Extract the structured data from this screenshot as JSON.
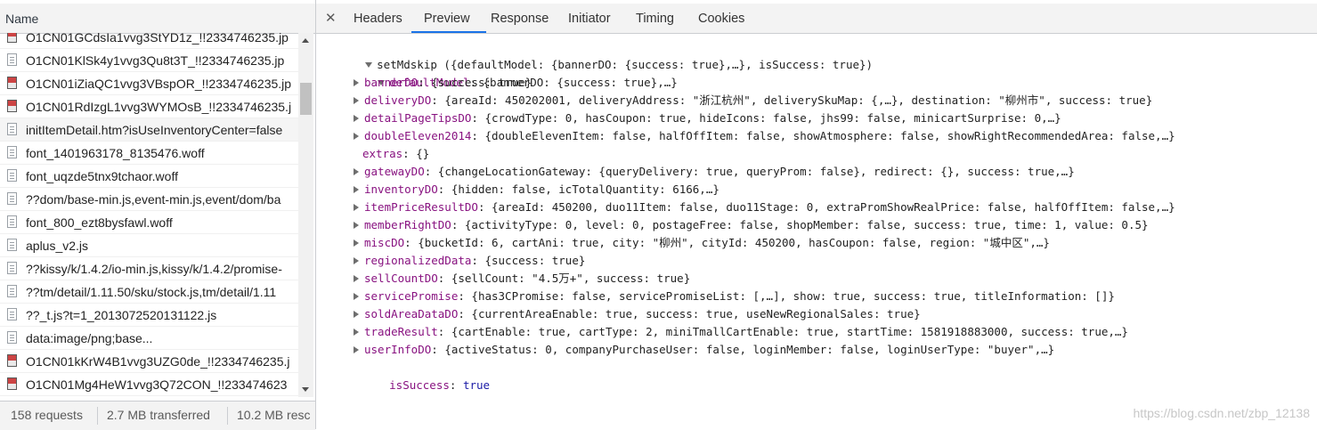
{
  "network": {
    "column_name": "Name",
    "files": [
      {
        "name": "O1CN01GCdsIa1vvg3StYD1z_!!2334746235.jp",
        "icon": "image-file-icon"
      },
      {
        "name": "O1CN01KlSk4y1vvg3Qu8t3T_!!2334746235.jp",
        "icon": "document-file-icon"
      },
      {
        "name": "O1CN01iZiaQC1vvg3VBspOR_!!2334746235.jp",
        "icon": "image-file-icon"
      },
      {
        "name": "O1CN01RdIzgL1vvg3WYMOsB_!!2334746235.j",
        "icon": "image-file-icon"
      },
      {
        "name": "initItemDetail.htm?isUseInventoryCenter=false",
        "icon": "document-file-icon"
      },
      {
        "name": "font_1401963178_8135476.woff",
        "icon": "document-file-icon"
      },
      {
        "name": "font_uqzde5tnx9tchaor.woff",
        "icon": "document-file-icon"
      },
      {
        "name": "??dom/base-min.js,event-min.js,event/dom/ba",
        "icon": "document-file-icon"
      },
      {
        "name": "font_800_ezt8bysfawl.woff",
        "icon": "document-file-icon"
      },
      {
        "name": "aplus_v2.js",
        "icon": "document-file-icon"
      },
      {
        "name": "??kissy/k/1.4.2/io-min.js,kissy/k/1.4.2/promise-",
        "icon": "document-file-icon"
      },
      {
        "name": "??tm/detail/1.11.50/sku/stock.js,tm/detail/1.11",
        "icon": "document-file-icon"
      },
      {
        "name": "??_t.js?t=1_2013072520131122.js",
        "icon": "document-file-icon"
      },
      {
        "name": "data:image/png;base...",
        "icon": "document-file-icon"
      },
      {
        "name": "O1CN01kKrW4B1vvg3UZG0de_!!2334746235.j",
        "icon": "image-file-icon"
      },
      {
        "name": "O1CN01Mg4HeW1vvg3Q72CON_!!233474623",
        "icon": "image-file-icon"
      }
    ]
  },
  "status": {
    "requests": "158 requests",
    "transferred": "2.7 MB transferred",
    "resources": "10.2 MB resc"
  },
  "tabs": [
    "Headers",
    "Preview",
    "Response",
    "Initiator",
    "Timing",
    "Cookies"
  ],
  "active_tab": "Preview",
  "preview": {
    "root": "setMdskip ({defaultModel: {bannerDO: {success: true},…}, isSuccess: true})",
    "default_model_key": "defaultModel",
    "default_model_summary": "{bannerDO: {success: true},…}",
    "entries": [
      {
        "key": "bannerDO",
        "value": "{success: true}",
        "expandable": true
      },
      {
        "key": "deliveryDO",
        "value": "{areaId: 450202001, deliveryAddress: \"浙江杭州\", deliverySkuMap: {,…}, destination: \"柳州市\", success: true}",
        "expandable": true
      },
      {
        "key": "detailPageTipsDO",
        "value": "{crowdType: 0, hasCoupon: true, hideIcons: false, jhs99: false, minicartSurprise: 0,…}",
        "expandable": true
      },
      {
        "key": "doubleEleven2014",
        "value": "{doubleElevenItem: false, halfOffItem: false, showAtmosphere: false, showRightRecommendedArea: false,…}",
        "expandable": true
      },
      {
        "key": "extras",
        "value": "{}",
        "expandable": false
      },
      {
        "key": "gatewayDO",
        "value": "{changeLocationGateway: {queryDelivery: true, queryProm: false}, redirect: {}, success: true,…}",
        "expandable": true
      },
      {
        "key": "inventoryDO",
        "value": "{hidden: false, icTotalQuantity: 6166,…}",
        "expandable": true
      },
      {
        "key": "itemPriceResultDO",
        "value": "{areaId: 450200, duo11Item: false, duo11Stage: 0, extraPromShowRealPrice: false, halfOffItem: false,…}",
        "expandable": true
      },
      {
        "key": "memberRightDO",
        "value": "{activityType: 0, level: 0, postageFree: false, shopMember: false, success: true, time: 1, value: 0.5}",
        "expandable": true
      },
      {
        "key": "miscDO",
        "value": "{bucketId: 6, cartAni: true, city: \"柳州\", cityId: 450200, hasCoupon: false, region: \"城中区\",…}",
        "expandable": true
      },
      {
        "key": "regionalizedData",
        "value": "{success: true}",
        "expandable": true
      },
      {
        "key": "sellCountDO",
        "value": "{sellCount: \"4.5万+\", success: true}",
        "expandable": true
      },
      {
        "key": "servicePromise",
        "value": "{has3CPromise: false, servicePromiseList: [,…], show: true, success: true, titleInformation: []}",
        "expandable": true
      },
      {
        "key": "soldAreaDataDO",
        "value": "{currentAreaEnable: true, success: true, useNewRegionalSales: true}",
        "expandable": true
      },
      {
        "key": "tradeResult",
        "value": "{cartEnable: true, cartType: 2, miniTmallCartEnable: true, startTime: 1581918883000, success: true,…}",
        "expandable": true
      },
      {
        "key": "userInfoDO",
        "value": "{activeStatus: 0, companyPurchaseUser: false, loginMember: false, loginUserType: \"buyer\",…}",
        "expandable": true
      }
    ],
    "is_success_key": "isSuccess",
    "is_success_value": "true"
  },
  "watermark": "https://blog.csdn.net/zbp_12138"
}
